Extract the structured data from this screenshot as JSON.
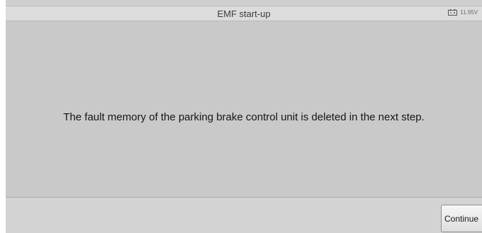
{
  "header": {
    "title": "EMF start-up",
    "battery_icon": "battery-icon",
    "voltage": "11.95V"
  },
  "main": {
    "message": "The fault memory of the parking brake control unit is deleted in the next step."
  },
  "footer": {
    "continue_label": "Continue"
  }
}
